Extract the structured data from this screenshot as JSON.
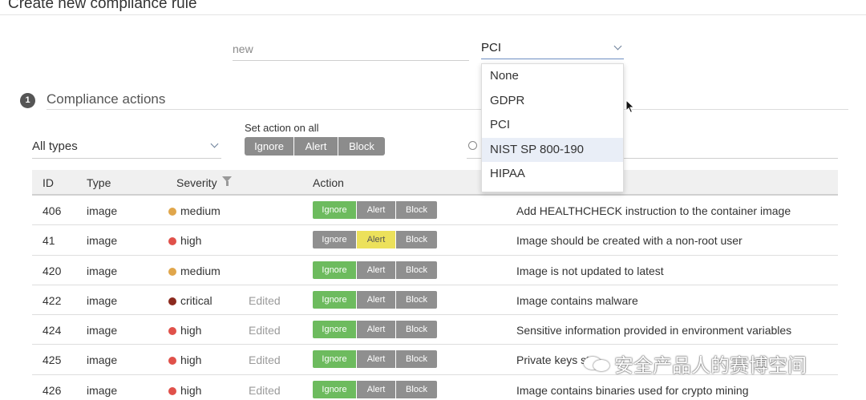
{
  "page": {
    "title": "Create new compliance rule"
  },
  "rule": {
    "name_placeholder": "new",
    "standard_selected": "PCI",
    "standard_options": [
      "None",
      "GDPR",
      "PCI",
      "NIST SP 800-190",
      "HIPAA"
    ],
    "highlighted_option": "NIST SP 800-190"
  },
  "section": {
    "number": "1",
    "title": "Compliance actions"
  },
  "filters": {
    "type_select": "All types",
    "set_action_label": "Set action on all",
    "set_action_buttons": [
      "Ignore",
      "Alert",
      "Block"
    ]
  },
  "table": {
    "headers": {
      "id": "ID",
      "type": "Type",
      "severity": "Severity",
      "action": "Action"
    },
    "action_labels": {
      "ignore": "Ignore",
      "alert": "Alert",
      "block": "Block"
    },
    "rows": [
      {
        "id": "406",
        "type": "image",
        "severity": "medium",
        "severity_color": "#e0a64b",
        "edited": "",
        "action": "ignore",
        "description": "Add HEALTHCHECK instruction to the container image"
      },
      {
        "id": "41",
        "type": "image",
        "severity": "high",
        "severity_color": "#e0514a",
        "edited": "",
        "action": "alert",
        "description": "Image should be created with a non-root user"
      },
      {
        "id": "420",
        "type": "image",
        "severity": "medium",
        "severity_color": "#e0a64b",
        "edited": "",
        "action": "ignore",
        "description": "Image is not updated to latest"
      },
      {
        "id": "422",
        "type": "image",
        "severity": "critical",
        "severity_color": "#8b2a1e",
        "edited": "Edited",
        "action": "ignore",
        "description": "Image contains malware"
      },
      {
        "id": "424",
        "type": "image",
        "severity": "high",
        "severity_color": "#e0514a",
        "edited": "Edited",
        "action": "ignore",
        "description": "Sensitive information provided in environment variables"
      },
      {
        "id": "425",
        "type": "image",
        "severity": "high",
        "severity_color": "#e0514a",
        "edited": "Edited",
        "action": "ignore",
        "description": "Private keys st"
      },
      {
        "id": "426",
        "type": "image",
        "severity": "high",
        "severity_color": "#e0514a",
        "edited": "Edited",
        "action": "ignore",
        "description": "Image contains binaries used for crypto mining"
      }
    ]
  },
  "watermark": {
    "text": "安全产品人的赛博空间"
  },
  "colors": {
    "ignore_active": "#6dbb5e",
    "alert_active": "#ece15b",
    "inactive": "#8f8f8f"
  }
}
